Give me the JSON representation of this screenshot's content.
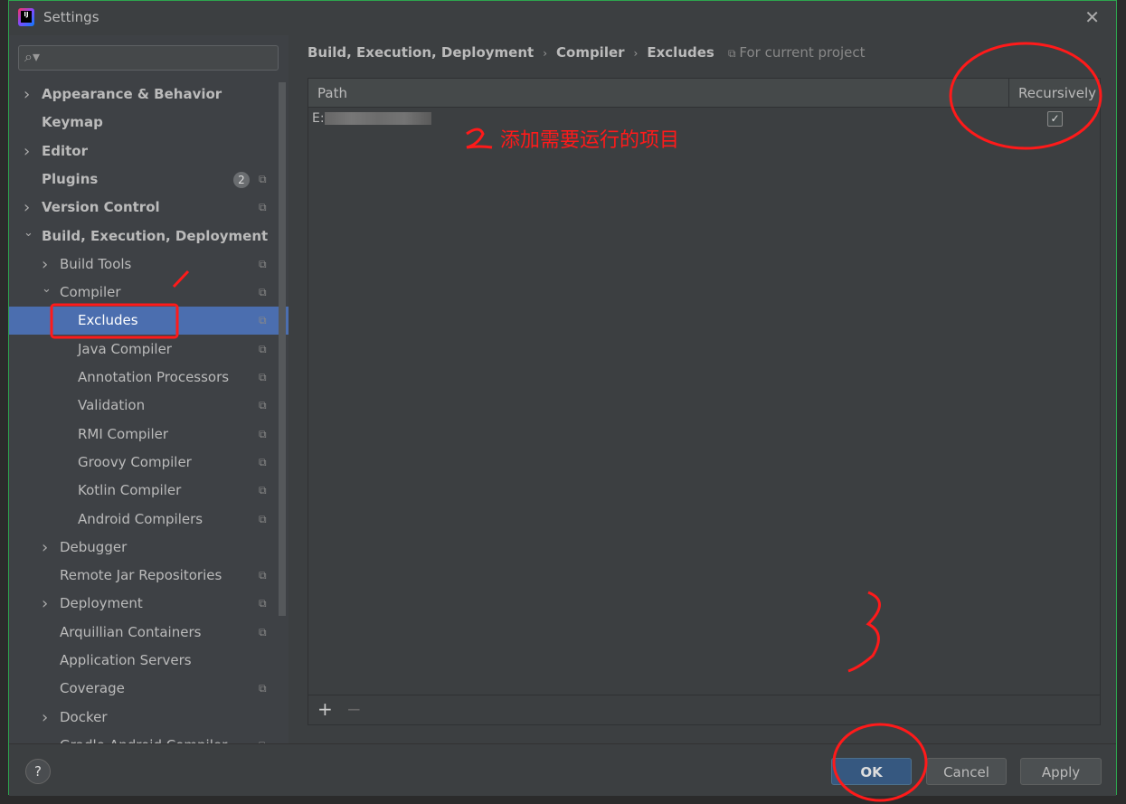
{
  "window": {
    "title": "Settings",
    "close_icon": "close-icon"
  },
  "sidebar": {
    "search_placeholder": "",
    "items": [
      {
        "label": "Appearance & Behavior",
        "level": 0,
        "expand": "collapsed",
        "bold": true
      },
      {
        "label": "Keymap",
        "level": 0,
        "bold": true
      },
      {
        "label": "Editor",
        "level": 0,
        "expand": "collapsed",
        "bold": true
      },
      {
        "label": "Plugins",
        "level": 0,
        "bold": true,
        "badge": "2",
        "copy": true
      },
      {
        "label": "Version Control",
        "level": 0,
        "expand": "collapsed",
        "bold": true,
        "copy": true
      },
      {
        "label": "Build, Execution, Deployment",
        "level": 0,
        "expand": "expanded",
        "bold": true
      },
      {
        "label": "Build Tools",
        "level": 1,
        "expand": "collapsed",
        "copy": true
      },
      {
        "label": "Compiler",
        "level": 1,
        "expand": "expanded",
        "copy": true
      },
      {
        "label": "Excludes",
        "level": 2,
        "selected": true,
        "copy": true
      },
      {
        "label": "Java Compiler",
        "level": 2,
        "copy": true
      },
      {
        "label": "Annotation Processors",
        "level": 2,
        "copy": true
      },
      {
        "label": "Validation",
        "level": 2,
        "copy": true
      },
      {
        "label": "RMI Compiler",
        "level": 2,
        "copy": true
      },
      {
        "label": "Groovy Compiler",
        "level": 2,
        "copy": true
      },
      {
        "label": "Kotlin Compiler",
        "level": 2,
        "copy": true
      },
      {
        "label": "Android Compilers",
        "level": 2,
        "copy": true
      },
      {
        "label": "Debugger",
        "level": 1,
        "expand": "collapsed"
      },
      {
        "label": "Remote Jar Repositories",
        "level": 1,
        "copy": true
      },
      {
        "label": "Deployment",
        "level": 1,
        "expand": "collapsed",
        "copy": true
      },
      {
        "label": "Arquillian Containers",
        "level": 1,
        "copy": true
      },
      {
        "label": "Application Servers",
        "level": 1
      },
      {
        "label": "Coverage",
        "level": 1,
        "copy": true
      },
      {
        "label": "Docker",
        "level": 1,
        "expand": "collapsed"
      },
      {
        "label": "Gradle-Android Compiler",
        "level": 1,
        "copy": true
      }
    ]
  },
  "breadcrumb": [
    "Build, Execution, Deployment",
    "Compiler",
    "Excludes"
  ],
  "scope_label": "For current project",
  "table": {
    "columns": [
      "Path",
      "Recursively"
    ],
    "rows": [
      {
        "path": "E:",
        "recursively": true
      }
    ]
  },
  "toolbar": {
    "add": "+",
    "remove": "−"
  },
  "buttons": {
    "help": "?",
    "ok": "OK",
    "cancel": "Cancel",
    "apply": "Apply"
  },
  "annotations": {
    "note": "添加需要运行的项目",
    "step1": "1",
    "step2": "2",
    "step3": "3",
    "color": "#ff1a1a"
  },
  "colors": {
    "selection": "#4b6eaf",
    "ok_button": "#365880",
    "background": "#3c3f41"
  }
}
